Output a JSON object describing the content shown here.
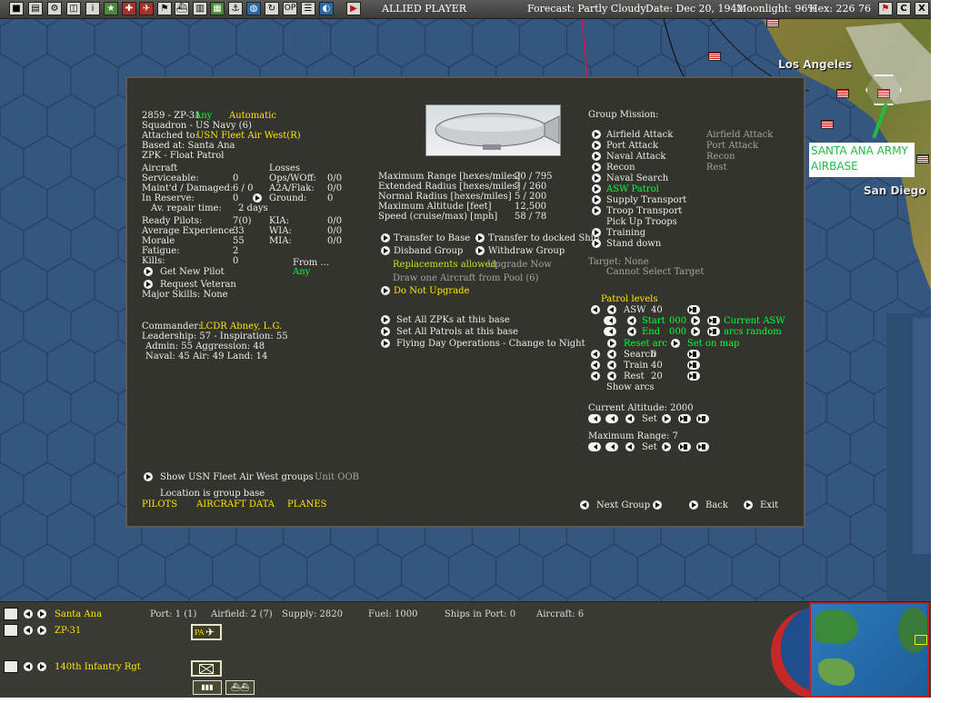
{
  "topbar": {
    "buttons": [
      "ai-toggle-icon",
      "report-icon",
      "options-icon",
      "group-icon",
      "info-icon",
      "star-icon",
      "ground-unit-icon",
      "air-unit-icon",
      "flag-icon",
      "ship-icon",
      "chart-icon",
      "map-icon",
      "ship-list-icon",
      "globe-icon",
      "op-icon",
      "list-icon",
      "replay-icon",
      "end-turn-icon"
    ],
    "op_label": "OP",
    "info_label": "i",
    "side": "ALLIED PLAYER",
    "forecast": "Forecast: Partly Cloudy",
    "date": "Date: Dec 20, 1942",
    "moonlight": "Moonlight: 96%",
    "hex": "Hex: 226 76",
    "right_c": "C",
    "right_x": "X"
  },
  "map": {
    "city_la": "Los Angeles",
    "city_sd": "San Diego",
    "airbase_label": "SANTA ANA ARMY AIRBASE"
  },
  "unit": {
    "header_id": "2859 - ZP-31",
    "header_any": "Any",
    "header_auto": "Automatic",
    "squadron": "Squadron - US Navy (6)",
    "attached_label": "Attached to:",
    "attached_value": "USN Fleet Air West(R)",
    "based_at": "Based at: Santa Ana",
    "aircraft_type": "ZPK - Float Patrol",
    "aircraft_hdr": "Aircraft",
    "losses_hdr": "Losses",
    "serviceable_label": "Serviceable:",
    "serviceable_val": "0",
    "maintd_label": "Maint'd / Damaged:",
    "maintd_val": "6 / 0",
    "reserve_label": "In Reserve:",
    "reserve_val": "0",
    "repair_label": "Av. repair time:",
    "repair_val": "2 days",
    "ops_label": "Ops/WOff:",
    "ops_val": "0/0",
    "a2a_label": "A2A/Flak:",
    "a2a_val": "0/0",
    "ground_label": "Ground:",
    "ground_val": "0",
    "ready_label": "Ready Pilots:",
    "ready_val": "7(0)",
    "exp_label": "Average Experience",
    "exp_val": "33",
    "morale_label": "Morale",
    "morale_val": "55",
    "fatigue_label": "Fatigue:",
    "fatigue_val": "2",
    "kills_label": "Kills:",
    "kills_val": "0",
    "kia_label": "KIA:",
    "kia_val": "0/0",
    "wia_label": "WIA:",
    "wia_val": "0/0",
    "mia_label": "MIA:",
    "mia_val": "0/0",
    "from_label": "From ...",
    "from_val": "Any",
    "get_pilot": "Get New Pilot",
    "request_veteran": "Request Veteran",
    "major_skills": "Major Skills:  None",
    "commander_label": "Commander:",
    "commander_name": "LCDR Abney, L.G.",
    "leadership": "Leadership: 57 - Inspiration: 55",
    "admin": "Admin: 55  Aggression: 48",
    "naval": "Naval: 45  Air: 49  Land: 14",
    "show_groups": "Show USN Fleet Air West groups",
    "unit_oob": "Unit OOB",
    "location_note": "Location is group base",
    "tab_pilots": "PILOTS",
    "tab_aircraft": "AIRCRAFT DATA",
    "tab_planes": "PLANES"
  },
  "range": {
    "max_range_label": "Maximum Range [hexes/miles]",
    "max_range_val": "20 / 795",
    "ext_label": "Extended Radius [hexes/miles]",
    "ext_val": "7 / 260",
    "norm_label": "Normal Radius [hexes/miles]",
    "norm_val": "5 / 200",
    "alt_label": "Maximum Altitude [feet]",
    "alt_val": "12,500",
    "speed_label": "Speed (cruise/max) [mph]",
    "speed_val": "58 / 78",
    "transfer_base": "Transfer to Base",
    "transfer_ship": "Transfer to docked Ship",
    "disband": "Disband Group",
    "withdraw": "Withdraw Group",
    "replacements": "Replacements allowed",
    "upgrade_now": "Upgrade Now",
    "draw_aircraft": "Draw one Aircraft from Pool (6)",
    "no_upgrade": "Do Not Upgrade",
    "set_zpk": "Set All ZPKs at this base",
    "set_patrols": "Set All Patrols at this base",
    "flying_day": "Flying Day Operations - Change to Night"
  },
  "mission": {
    "header": "Group Mission:",
    "items": [
      "Airfield Attack",
      "Port Attack",
      "Naval Attack",
      "Recon",
      "Naval Search",
      "ASW Patrol",
      "Supply Transport",
      "Troop Transport",
      "Pick Up Troops",
      "Training",
      "Stand down"
    ],
    "secondary": [
      "Airfield Attack",
      "Port Attack",
      "Recon",
      "Rest"
    ],
    "target": "Target: None",
    "cannot_select": "Cannot Select Target",
    "patrol_levels": "Patrol levels",
    "asw_label": "ASW",
    "asw_val": "40",
    "start_label": "Start",
    "start_val": "000",
    "end_label": "End",
    "end_val": "000",
    "current_asw": "Current ASW",
    "arcs_random": "arcs random",
    "reset_arc": "Reset arc",
    "set_on_map": "Set on map",
    "search_label": "Search",
    "search_val": "0",
    "train_label": "Train",
    "train_val": "40",
    "rest_label": "Rest",
    "rest_val": "20",
    "show_arcs": "Show arcs",
    "current_alt": "Current Altitude: 2000",
    "set_label": "Set",
    "max_range": "Maximum Range: 7",
    "next_group": "Next Group",
    "back": "Back",
    "exit": "Exit"
  },
  "bottom": {
    "base_name": "Santa Ana",
    "port": "Port: 1 (1)",
    "airfield": "Airfield: 2 (7)",
    "supply": "Supply: 2820",
    "fuel": "Fuel: 1000",
    "ships": "Ships in Port: 0",
    "aircraft": "Aircraft: 6",
    "group_name": "ZP-31",
    "pa_badge": "PA",
    "ground_unit": "140th Infantry Rgt"
  },
  "colors": {
    "highlight_yellow": "#ffe600",
    "active_green": "#00ff3a",
    "panel_bg": "#34342f",
    "ocean": "#35567e"
  }
}
